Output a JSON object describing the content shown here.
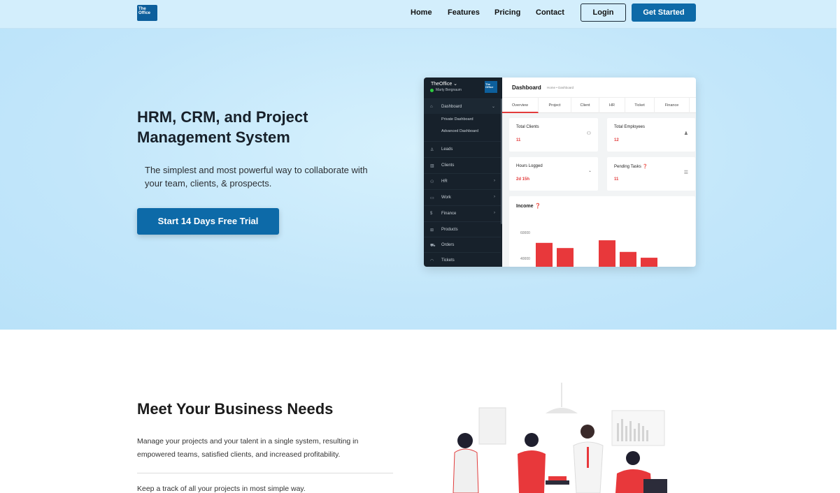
{
  "nav": {
    "logo_text": "The Office",
    "links": [
      "Home",
      "Features",
      "Pricing",
      "Contact"
    ],
    "login_label": "Login",
    "get_started_label": "Get Started"
  },
  "hero": {
    "title": "HRM, CRM, and Project Management System",
    "subtitle": "The simplest and most powerful way to collaborate with your team, clients, & prospects.",
    "cta_label": "Start 14 Days Free Trial"
  },
  "dashboard_mock": {
    "brand": "TheOffice",
    "user": "Marty Bergnaum",
    "logo_text": "The Office",
    "header_title": "Dashboard",
    "breadcrumb": "Home • Dashboard",
    "sidebar": [
      {
        "label": "Dashboard",
        "icon": "home-icon",
        "chevron": "down"
      },
      {
        "label": "Leads",
        "icon": "user-icon",
        "chevron": ""
      },
      {
        "label": "Clients",
        "icon": "chart-icon",
        "chevron": ""
      },
      {
        "label": "HR",
        "icon": "users-icon",
        "chevron": "right"
      },
      {
        "label": "Work",
        "icon": "briefcase-icon",
        "chevron": "right"
      },
      {
        "label": "Finance",
        "icon": "dollar-icon",
        "chevron": "right"
      },
      {
        "label": "Products",
        "icon": "basket-icon",
        "chevron": ""
      },
      {
        "label": "Orders",
        "icon": "cart-icon",
        "chevron": ""
      },
      {
        "label": "Tickets",
        "icon": "headset-icon",
        "chevron": ""
      }
    ],
    "sub_items": [
      "Private Dashboard",
      "Advanced Dashboard"
    ],
    "tabs": [
      "Overview",
      "Project",
      "Client",
      "HR",
      "Ticket",
      "Finance"
    ],
    "active_tab": "Overview",
    "cards": [
      {
        "title": "Total Clients",
        "value": "11",
        "icon": "users-icon"
      },
      {
        "title": "Total Employees",
        "value": "12",
        "icon": "user-icon"
      },
      {
        "title": "Hours Logged",
        "value": "2d 15h",
        "icon": "clock-icon"
      },
      {
        "title": "Pending Tasks",
        "value": "11",
        "icon": "list-icon"
      }
    ],
    "income": {
      "title": "Income",
      "chart_data": {
        "type": "bar",
        "tick_labels": [
          "60000",
          "40000"
        ],
        "values": [
          52000,
          48000,
          54000,
          45000,
          40500
        ],
        "bar_color": "#e8383b"
      }
    }
  },
  "section2": {
    "title": "Meet Your Business Needs",
    "text": "Manage your projects and your talent in a single system, resulting in empowered teams, satisfied clients, and increased profitability.",
    "text2": "Keep a track of all your projects in most simple way."
  },
  "colors": {
    "brand": "#0d6aa8",
    "accent_red": "#e8383b",
    "hero_bg": "#c2e6fa",
    "sidebar_bg": "#17212b"
  }
}
